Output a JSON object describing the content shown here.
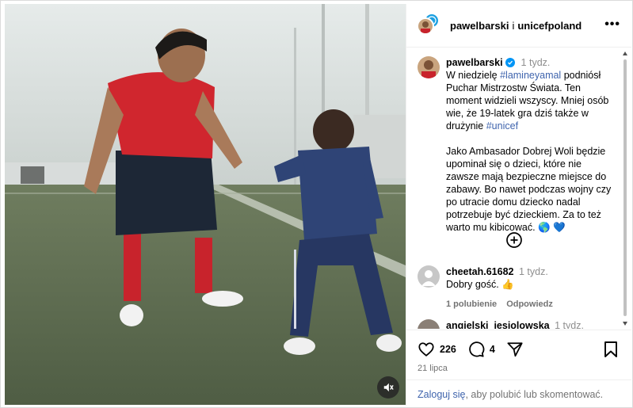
{
  "header": {
    "author": "pawelbarski",
    "separator": "i",
    "coauthor": "unicefpoland",
    "more_label": "•••"
  },
  "caption": {
    "username": "pawelbarski",
    "time": "1 tydz.",
    "p1_a": "W niedzielę ",
    "p1_tag1": "#lamineyamal",
    "p1_b": " podniósł Puchar Mistrzostw Świata. Ten moment widzieli wszyscy. Mniej osób wie, że 19-latek gra dziś także w drużynie ",
    "p1_tag2": "#unicef",
    "p2": "Jako Ambasador Dobrej Woli będzie upominał się o dzieci, które nie zawsze mają bezpieczne miejsce do zabawy. Bo nawet podczas wojny czy po utracie domu dziecko nadal potrzebuje być dzieckiem. Za to też warto mu kibicować. 🌎 💙"
  },
  "comments": [
    {
      "username": "cheetah.61682",
      "time": "1 tydz.",
      "text": "Dobry gość. 👍",
      "likes": "1 polubienie",
      "reply": "Odpowiedz"
    },
    {
      "username": "angielski_jesiolowska",
      "time": "1 tydz."
    }
  ],
  "actions": {
    "likes": "226",
    "comments": "4",
    "date": "21 lipca"
  },
  "login": {
    "link": "Zaloguj się",
    "rest": ", aby polubić lub skomentować."
  },
  "colors": {
    "link": "#3f64ad",
    "verified": "#0095f6",
    "muted": "#8e8e8e"
  }
}
